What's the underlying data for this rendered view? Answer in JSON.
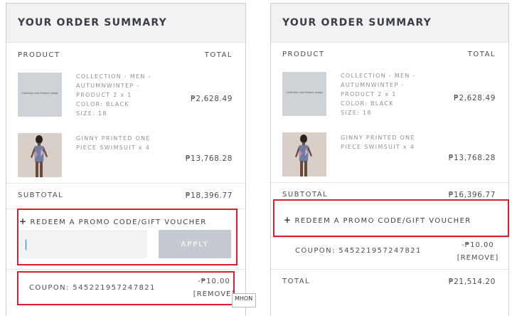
{
  "left": {
    "title": "YOUR ORDER SUMMARY",
    "col_product": "PRODUCT",
    "col_total": "TOTAL",
    "items": [
      {
        "thumb_text": "Collection and Product image",
        "lines": [
          "COLLECTION - MEN -",
          "AUTUMNWINTEP -",
          "PRODUCT 2  x 1",
          "COLOR: BLACK",
          "SIZE: 18"
        ],
        "price": "₱2,628.49"
      },
      {
        "lines": [
          "GINNY PRINTED ONE",
          "PIECE SWIMSUIT  x 4"
        ],
        "price": "₱13,768.28"
      }
    ],
    "subtotal_label": "SUBTOTAL",
    "subtotal_value": "₱18,396.77",
    "promo_label": "REDEEM A PROMO CODE/GIFT VOUCHER",
    "promo_input_value": "",
    "apply_label": "APPLY",
    "coupon_label": "COUPON: 545221957247821",
    "coupon_amount": "-₱10.00",
    "remove_label": "[REMOVE]",
    "overlap_text": "MHON"
  },
  "right": {
    "title": "YOUR ORDER SUMMARY",
    "col_product": "PRODUCT",
    "col_total": "TOTAL",
    "items": [
      {
        "thumb_text": "Collection and Product image",
        "lines": [
          "COLLECTION - MEN -",
          "AUTUMNWINTEP -",
          "PRODUCT 2  x 1",
          "COLOR: BLACK",
          "SIZE: 18"
        ],
        "price": "₱2,628.49"
      },
      {
        "lines": [
          "GINNY PRINTED ONE",
          "PIECE SWIMSUIT  x 4"
        ],
        "price": "₱13,768.28"
      }
    ],
    "subtotal_label": "SUBTOTAL",
    "subtotal_value": "₱16,396.77",
    "promo_label": "REDEEM A PROMO CODE/GIFT VOUCHER",
    "coupon_label": "COUPON: 545221957247821",
    "coupon_amount": "-₱10.00",
    "remove_label": "[REMOVE]",
    "total_label": "TOTAL",
    "total_value": "₱21,514.20"
  },
  "colors": {
    "highlight": "#d8202a",
    "apply_bg": "#c5cad0",
    "header_bg": "#f1f2f4"
  }
}
